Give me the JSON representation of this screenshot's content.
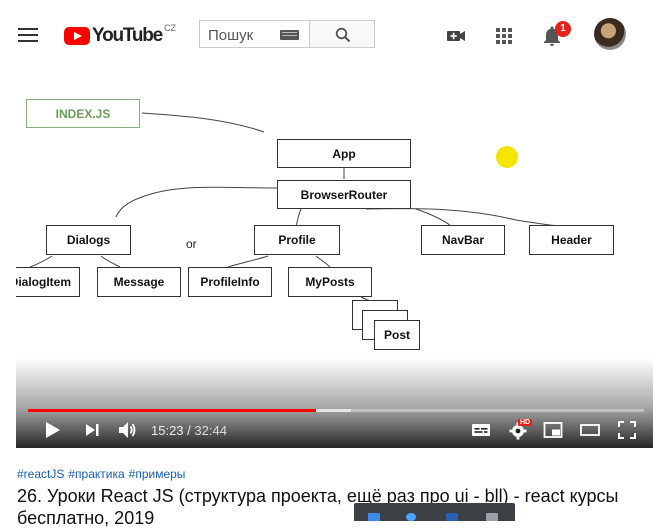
{
  "topbar": {
    "logo_text": "YouTube",
    "logo_country": "CZ",
    "search_placeholder": "Пошук",
    "notifications_count": "1"
  },
  "video": {
    "diagram": {
      "index_label": "INDEX.JS",
      "app": "App",
      "router": "BrowserRouter",
      "dialogs": "Dialogs",
      "or": "or",
      "profile": "Profile",
      "navbar": "NavBar",
      "header": "Header",
      "dialog_item": "DialogItem",
      "message": "Message",
      "profile_info": "ProfileInfo",
      "my_posts": "MyPosts",
      "post": "Post"
    },
    "player": {
      "current_time": "15:23",
      "separator": " / ",
      "duration": "32:44",
      "progress_fraction": 0.468,
      "buffered_fraction": 0.525,
      "quality_badge": "HD"
    }
  },
  "below": {
    "hashtags": [
      "#reactJS",
      "#практика",
      "#примеры"
    ],
    "title": "26. Уроки React JS (структура проекта, ещё раз про ui - bll) - react курсы бесплатно, 2019"
  },
  "colors": {
    "brand_red": "#ff0000",
    "progress_red": "#ff0000",
    "link_blue": "#1a5fb4",
    "index_green": "#6a9d5a",
    "marker_yellow": "#f5e400"
  },
  "icons": [
    "menu-icon",
    "keyboard-icon",
    "search-icon",
    "video-camera-icon",
    "apps-grid-icon",
    "bell-icon",
    "play-icon",
    "next-icon",
    "volume-icon",
    "subtitles-icon",
    "settings-icon",
    "miniplayer-icon",
    "theater-icon",
    "fullscreen-icon"
  ]
}
